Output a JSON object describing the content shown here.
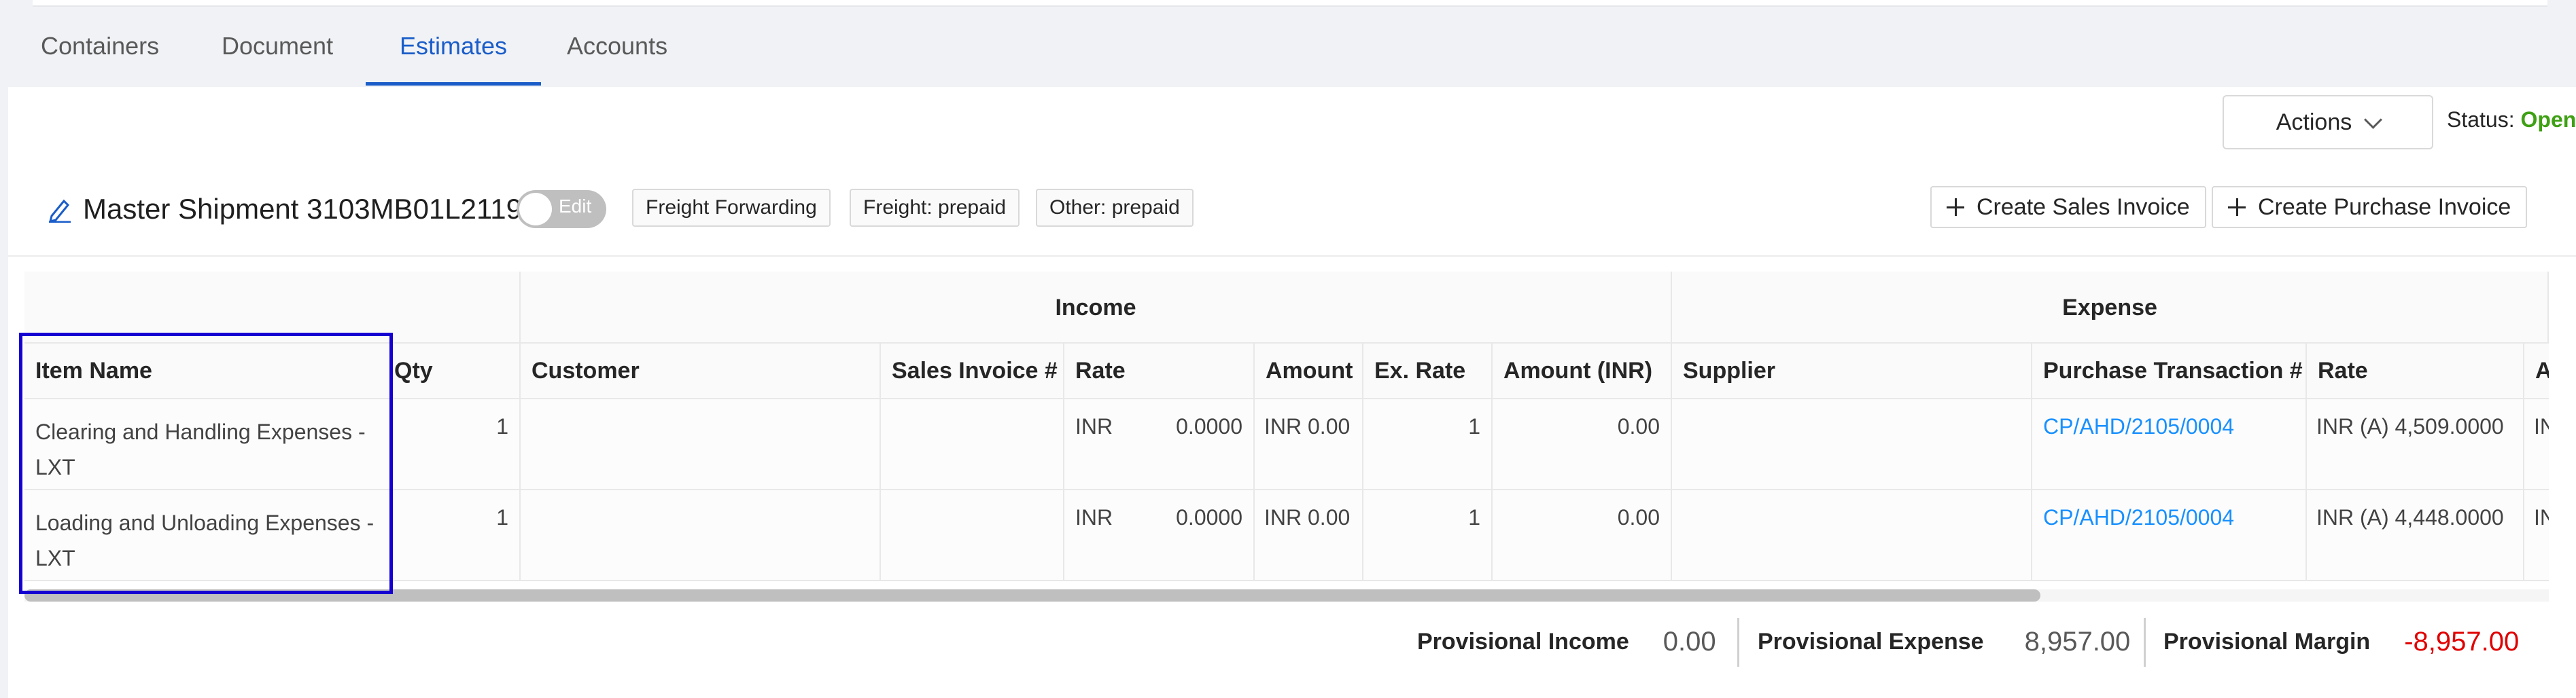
{
  "tabs": [
    "Containers",
    "Document",
    "Estimates",
    "Accounts"
  ],
  "active_tab": "Estimates",
  "actions": {
    "label": "Actions"
  },
  "status": {
    "label": "Status:",
    "value": "Open",
    "color": "#3fa014"
  },
  "shipment": {
    "title": "Master Shipment 3103MB01L2119",
    "toggle_label": "Edit",
    "tags": [
      "Freight Forwarding",
      "Freight: prepaid",
      "Other: prepaid"
    ]
  },
  "buttons": {
    "create_sales": "Create Sales Invoice",
    "create_purchase": "Create Purchase Invoice"
  },
  "table": {
    "groups": [
      "Income",
      "Expense"
    ],
    "columns": [
      "Item Name",
      "Qty",
      "Customer",
      "Sales Invoice #",
      "Rate",
      "Amount",
      "Ex. Rate",
      "Amount (INR)",
      "Supplier",
      "Purchase Transaction #",
      "Rate",
      "A"
    ],
    "rows": [
      {
        "item": "Clearing and Handling Expenses - LXT",
        "qty": "1",
        "customer": "",
        "sales_invoice": "",
        "rate_currency": "INR",
        "rate_value": "0.0000",
        "amount": "INR 0.00",
        "ex_rate": "1",
        "amount_inr": "0.00",
        "supplier": "",
        "purchase_txn": "CP/AHD/2105/0004",
        "exp_rate": "INR (A) 4,509.0000",
        "exp_amount": "IN"
      },
      {
        "item": "Loading and Unloading Expenses - LXT",
        "qty": "1",
        "customer": "",
        "sales_invoice": "",
        "rate_currency": "INR",
        "rate_value": "0.0000",
        "amount": "INR 0.00",
        "ex_rate": "1",
        "amount_inr": "0.00",
        "supplier": "",
        "purchase_txn": "CP/AHD/2105/0004",
        "exp_rate": "INR (A) 4,448.0000",
        "exp_amount": "IN"
      }
    ]
  },
  "summary": {
    "income_label": "Provisional Income",
    "income_value": "0.00",
    "expense_label": "Provisional Expense",
    "expense_value": "8,957.00",
    "margin_label": "Provisional Margin",
    "margin_value": "-8,957.00"
  },
  "colors": {
    "accent": "#1a5dc9",
    "link": "#1890ff",
    "negative": "#e00000",
    "highlight": "#1500d1"
  }
}
